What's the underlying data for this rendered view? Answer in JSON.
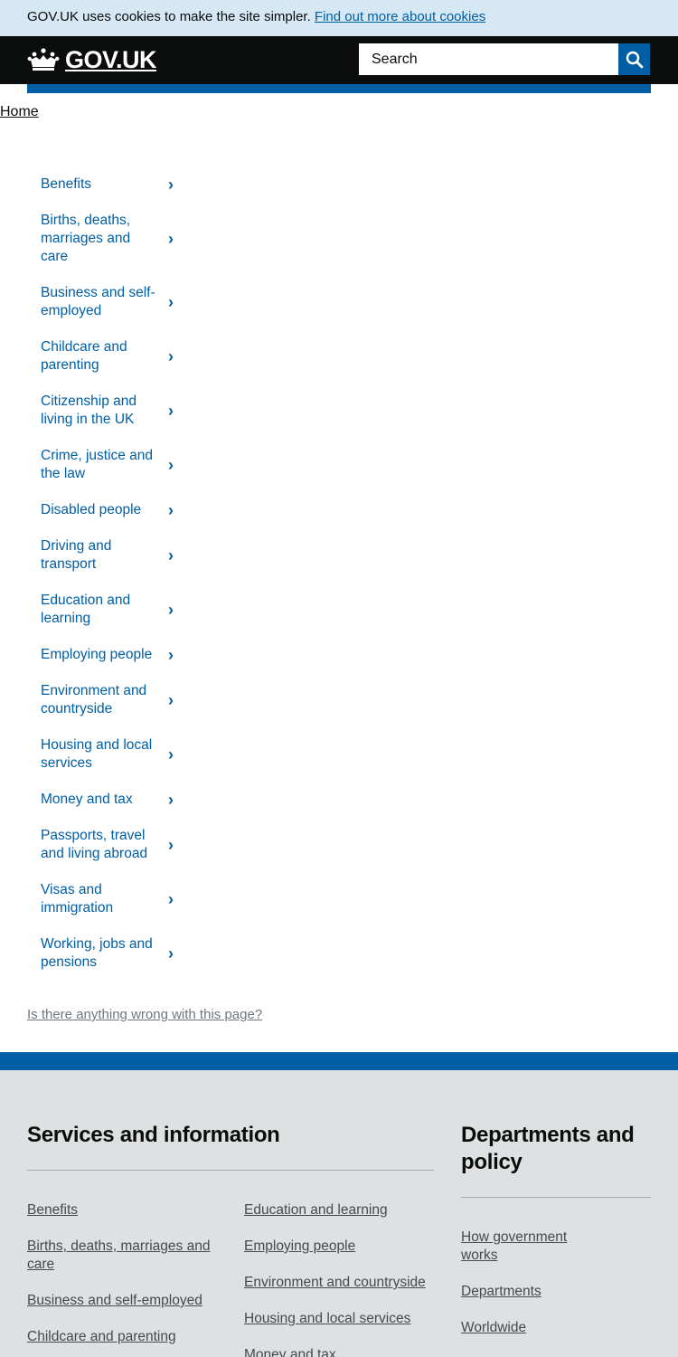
{
  "cookie_banner": {
    "text": "GOV.UK uses cookies to make the site simpler.",
    "link": "Find out more about cookies"
  },
  "header": {
    "logo_text": "GOV.UK",
    "logo_icon": "crown-icon",
    "search_placeholder": "Search",
    "search_icon": "search-icon"
  },
  "breadcrumb": {
    "home": "Home"
  },
  "browse": {
    "items": [
      "Benefits",
      "Births, deaths, marriages and care",
      "Business and self-employed",
      "Childcare and parenting",
      "Citizenship and living in the UK",
      "Crime, justice and the law",
      "Disabled people",
      "Driving and transport",
      "Education and learning",
      "Employing people",
      "Environment and countryside",
      "Housing and local services",
      "Money and tax",
      "Passports, travel and living abroad",
      "Visas and immigration",
      "Working, jobs and pensions"
    ],
    "chevron": "›"
  },
  "report_link": "Is there anything wrong with this page?",
  "footer": {
    "services_heading": "Services and information",
    "services_col1": [
      "Benefits",
      "Births, deaths, marriages and care",
      "Business and self-employed",
      "Childcare and parenting"
    ],
    "services_col2": [
      "Education and learning",
      "Employing people",
      "Environment and countryside",
      "Housing and local services",
      "Money and tax"
    ],
    "departments_heading": "Departments and policy",
    "departments_links": [
      "How government works",
      "Departments",
      "Worldwide"
    ]
  },
  "colors": {
    "link": "#005ea5",
    "header_bg": "#0b0c0c",
    "cookie_bg": "#d5e8f3",
    "footer_bg": "#dee0e2"
  }
}
